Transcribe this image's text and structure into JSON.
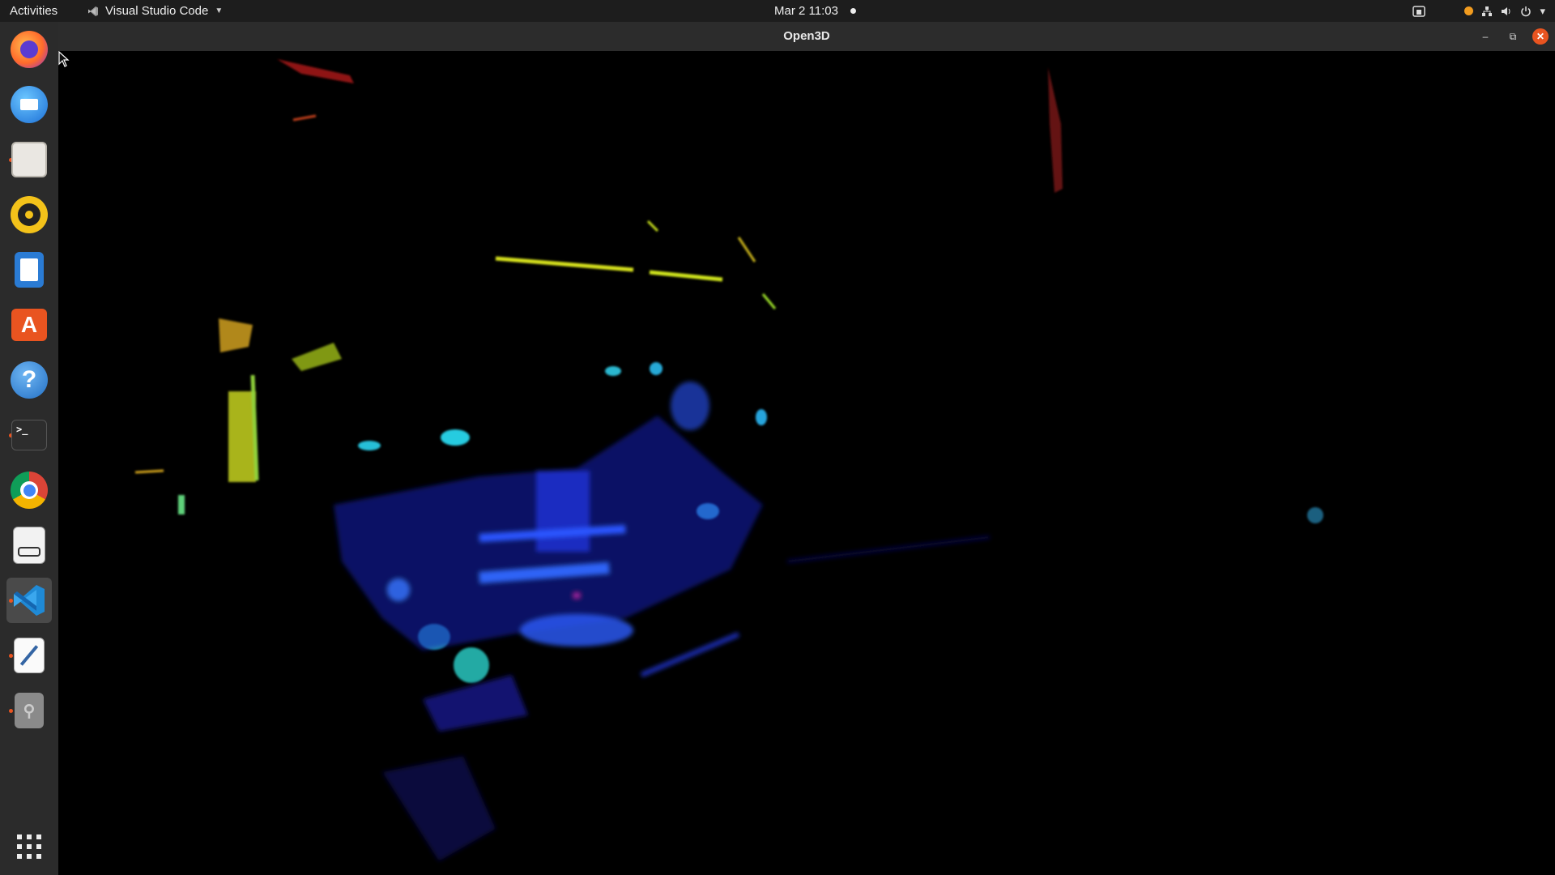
{
  "topbar": {
    "activities": "Activities",
    "app_menu": "Visual Studio Code",
    "clock": "Mar 2  11:03"
  },
  "dock": {
    "items": [
      {
        "name": "firefox",
        "icon": "firefox-icon"
      },
      {
        "name": "thunderbird",
        "icon": "thunderbird-icon"
      },
      {
        "name": "files",
        "icon": "files-icon"
      },
      {
        "name": "rhythmbox",
        "icon": "rhythmbox-icon"
      },
      {
        "name": "libreoffice-writer",
        "icon": "writer-icon"
      },
      {
        "name": "ubuntu-software",
        "icon": "software-store-icon"
      },
      {
        "name": "help",
        "icon": "help-icon"
      },
      {
        "name": "terminal",
        "icon": "terminal-icon"
      },
      {
        "name": "chrome",
        "icon": "chrome-icon"
      },
      {
        "name": "document-viewer",
        "icon": "document-viewer-icon"
      },
      {
        "name": "vscode",
        "icon": "vscode-icon",
        "active": true
      },
      {
        "name": "text-editor",
        "icon": "text-editor-icon"
      },
      {
        "name": "usb",
        "icon": "usb-icon"
      },
      {
        "name": "show-applications",
        "icon": "app-grid-icon"
      }
    ]
  },
  "window": {
    "title": "Open3D"
  },
  "colors": {
    "accent": "#e95420",
    "topbar_bg": "#1d1d1d",
    "dock_bg": "#2b2b2b",
    "titlebar_bg": "#2c2c2c"
  }
}
